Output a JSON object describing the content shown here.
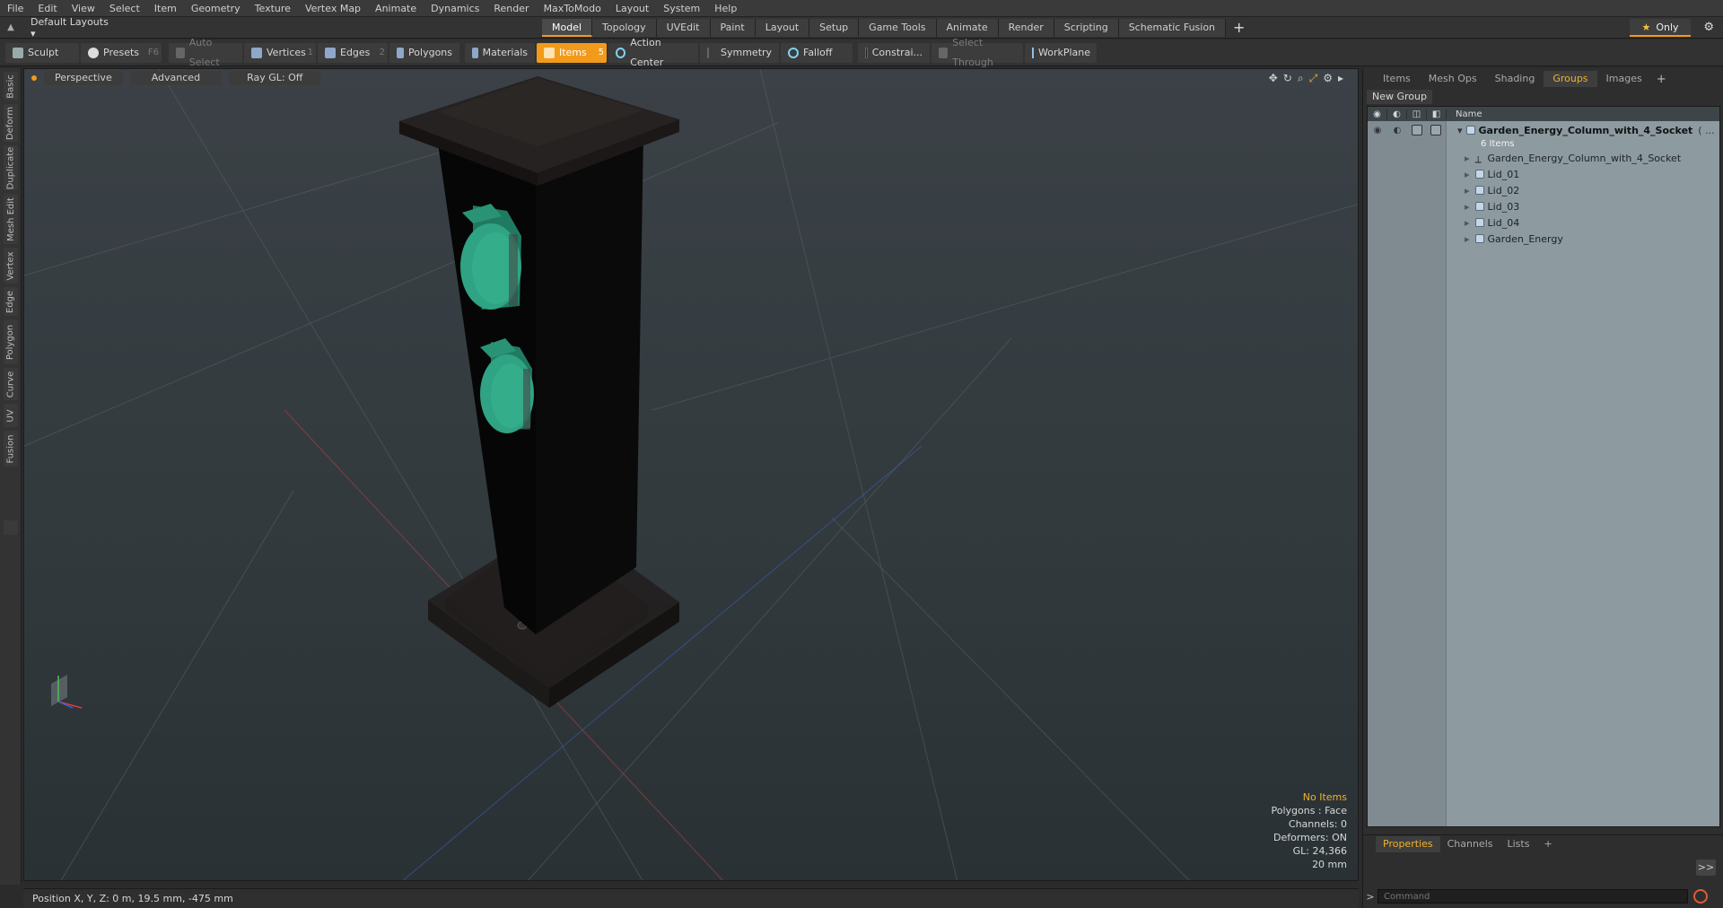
{
  "menu": [
    "File",
    "Edit",
    "View",
    "Select",
    "Item",
    "Geometry",
    "Texture",
    "Vertex Map",
    "Animate",
    "Dynamics",
    "Render",
    "MaxToModo",
    "Layout",
    "System",
    "Help"
  ],
  "layouts": {
    "label": "Default Layouts ▾"
  },
  "top_tabs": [
    "Model",
    "Topology",
    "UVEdit",
    "Paint",
    "Layout",
    "Setup",
    "Game Tools",
    "Animate",
    "Render",
    "Scripting",
    "Schematic Fusion"
  ],
  "active_top_tab": "Model",
  "only_label": "Only",
  "toolbar": {
    "sculpt": "Sculpt",
    "presets": "Presets",
    "presets_key": "F6",
    "auto_select": "Auto Select",
    "vertices": "Vertices",
    "vertices_num": "1",
    "edges": "Edges",
    "edges_num": "2",
    "polygons": "Polygons",
    "materials": "Materials",
    "items": "Items",
    "items_num": "5",
    "action_center": "Action Center",
    "symmetry": "Symmetry",
    "falloff": "Falloff",
    "constrain": "Constrai...",
    "select_through": "Select Through",
    "workplane": "WorkPlane"
  },
  "left_tabs": [
    "Basic",
    "Deform",
    "Duplicate",
    "Mesh Edit",
    "Vertex",
    "Edge",
    "Polygon",
    "Curve",
    "UV",
    "Fusion"
  ],
  "viewport": {
    "perspective": "Perspective",
    "advanced": "Advanced",
    "raygl": "Ray GL: Off",
    "info": {
      "no_items": "No Items",
      "polygons": "Polygons : Face",
      "channels": "Channels: 0",
      "deformers": "Deformers: ON",
      "gl": "GL: 24,366",
      "scale": "20 mm"
    }
  },
  "status": {
    "position": "Position X, Y, Z:  0 m, 19.5 mm, -475 mm"
  },
  "right_panel": {
    "tabs": [
      "Items",
      "Mesh Ops",
      "Shading",
      "Groups",
      "Images"
    ],
    "active_tab": "Groups",
    "new_group": "New Group",
    "name_header": "Name",
    "root": {
      "name": "Garden_Energy_Column_with_4_Socket",
      "suffix": "( ...",
      "count": "6 Items"
    },
    "children": [
      "Garden_Energy_Column_with_4_Socket",
      "Lid_01",
      "Lid_02",
      "Lid_03",
      "Lid_04",
      "Garden_Energy"
    ],
    "bottom_tabs": [
      "Properties",
      "Channels",
      "Lists"
    ],
    "active_bottom_tab": "Properties",
    "expand": ">>",
    "command_placeholder": "Command"
  },
  "colors": {
    "accent": "#f29a1a",
    "socket": "#2fa383",
    "column": "#0b0b0b"
  }
}
